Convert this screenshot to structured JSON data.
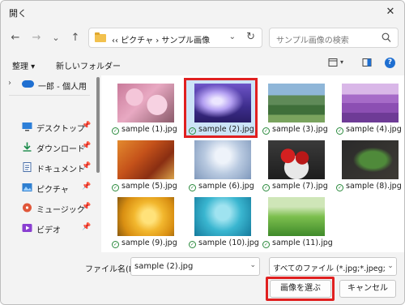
{
  "window": {
    "title": "開く"
  },
  "nav": {
    "back": "←",
    "forward": "→",
    "recent": "⌄",
    "up": "↑"
  },
  "address": {
    "path": "‹‹  ピクチャ  ›  サンプル画像",
    "refresh": "↻"
  },
  "search": {
    "placeholder": "サンプル画像の検索"
  },
  "commands": {
    "organize": "整理 ▾",
    "new_folder": "新しいフォルダー",
    "help": "?"
  },
  "sidebar": {
    "top": {
      "label": "一郎 - 個人用"
    },
    "items": [
      {
        "label": "デスクトップ",
        "icon": "desktop-icon"
      },
      {
        "label": "ダウンロード",
        "icon": "download-icon"
      },
      {
        "label": "ドキュメント",
        "icon": "document-icon"
      },
      {
        "label": "ピクチャ",
        "icon": "picture-icon"
      },
      {
        "label": "ミュージック",
        "icon": "music-icon"
      },
      {
        "label": "ビデオ",
        "icon": "video-icon"
      }
    ]
  },
  "files": [
    {
      "name": "sample (1).jpg"
    },
    {
      "name": "sample (2).jpg",
      "selected": true
    },
    {
      "name": "sample (3).jpg"
    },
    {
      "name": "sample (4).jpg"
    },
    {
      "name": "sample (5).jpg"
    },
    {
      "name": "sample (6).jpg"
    },
    {
      "name": "sample (7).jpg"
    },
    {
      "name": "sample (8).jpg"
    },
    {
      "name": "sample (9).jpg"
    },
    {
      "name": "sample (10).jpg"
    },
    {
      "name": "sample (11).jpg"
    }
  ],
  "footer": {
    "filename_label": "ファイル名(N):",
    "filename_value": "sample (2).jpg",
    "filter_value": "すべてのファイル (*.jpg;*.jpeg;*.bmp",
    "open_button": "画像を選ぶ",
    "cancel_button": "キャンセル"
  },
  "colors": {
    "accent": "#0067c0",
    "highlight": "#e02020",
    "selection": "#cce4f7"
  }
}
